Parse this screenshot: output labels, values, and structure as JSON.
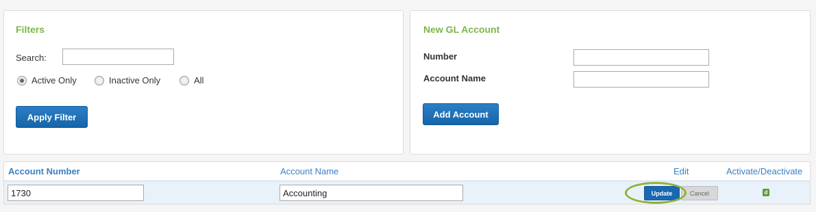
{
  "filters": {
    "title": "Filters",
    "search_label": "Search:",
    "search_value": "",
    "radios": [
      {
        "label": "Active Only",
        "checked": true
      },
      {
        "label": "Inactive Only",
        "checked": false
      },
      {
        "label": "All",
        "checked": false
      }
    ],
    "apply_label": "Apply Filter"
  },
  "new_account": {
    "title": "New GL Account",
    "number_label": "Number",
    "number_value": "",
    "name_label": "Account Name",
    "name_value": "",
    "add_label": "Add Account"
  },
  "grid": {
    "headers": {
      "account_number": "Account Number",
      "account_name": "Account Name",
      "edit": "Edit",
      "activate": "Activate/Deactivate"
    },
    "row": {
      "account_number": "1730",
      "account_name": "Accounting",
      "update_label": "Update",
      "cancel_label": "Cancel",
      "toggle_icon": "d"
    }
  },
  "colors": {
    "accent_green": "#7ab648",
    "header_blue": "#3a7fc1",
    "button_blue": "#1565a9",
    "highlight_ring": "#8db33a"
  }
}
